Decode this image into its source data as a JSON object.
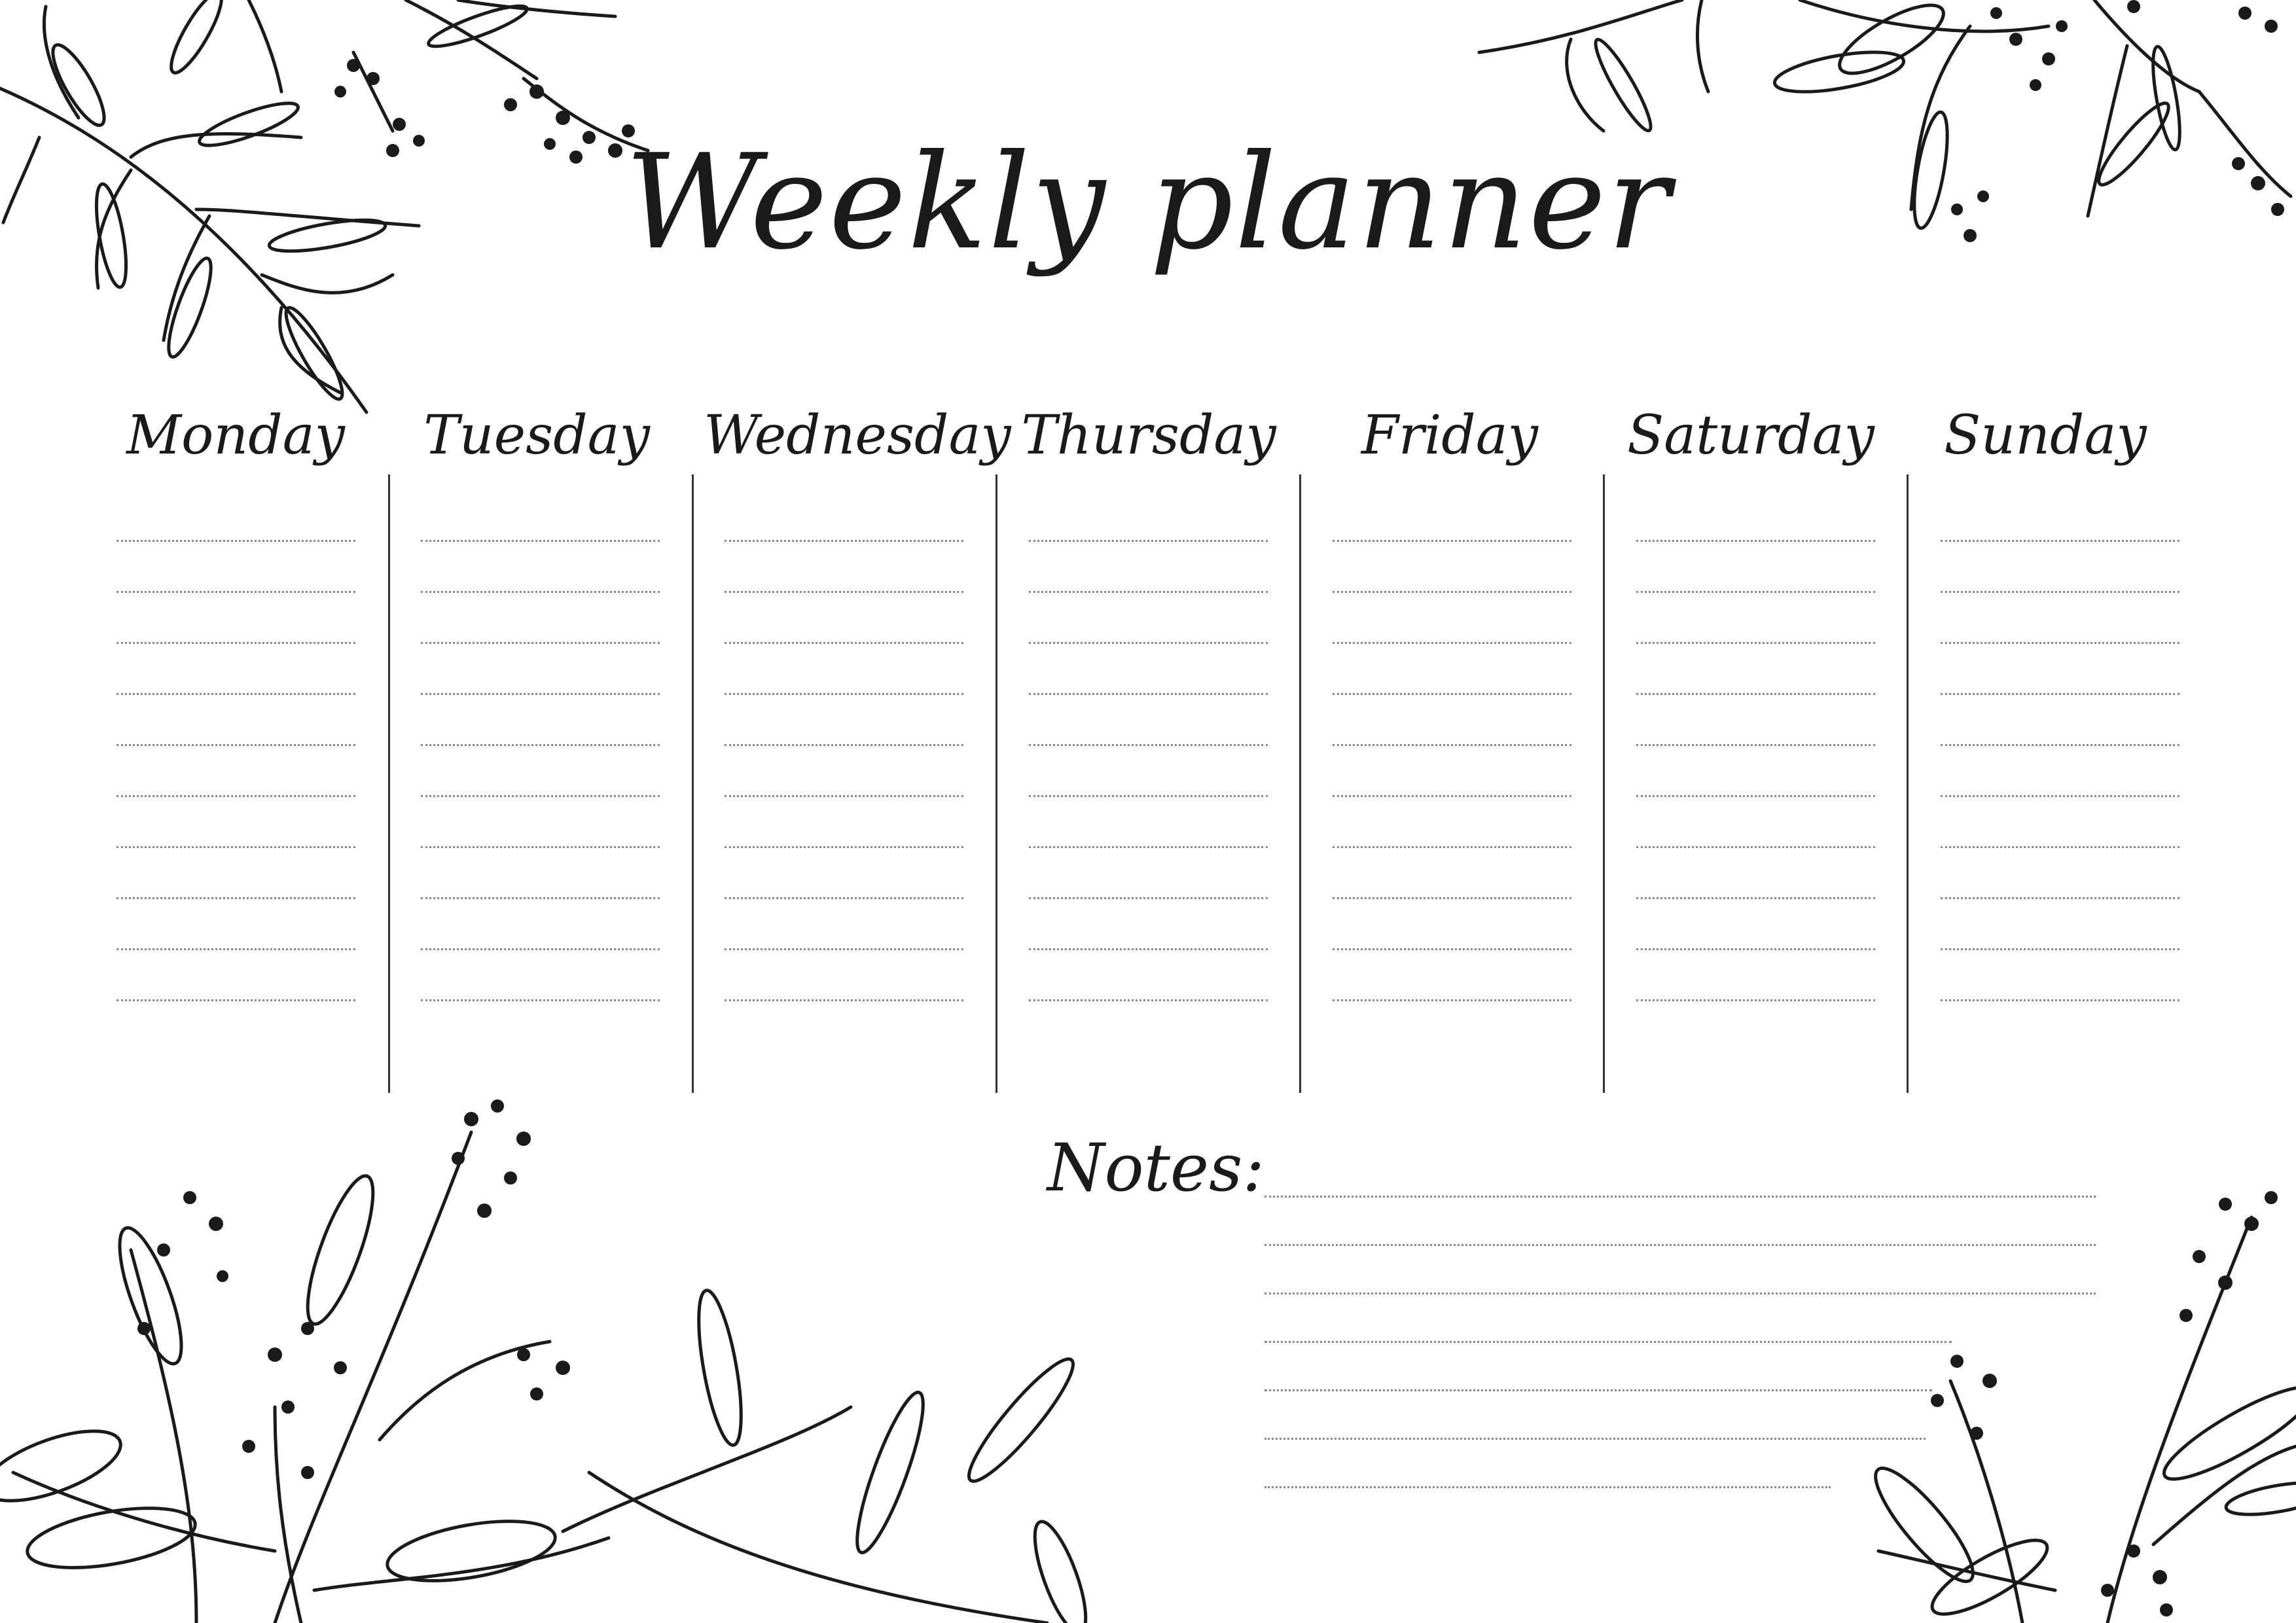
{
  "title": "Weekly planner",
  "days": [
    "Monday",
    "Tuesday",
    "Wednesday",
    "Thursday",
    "Friday",
    "Saturday",
    "Sunday"
  ],
  "notes_label": "Notes:",
  "lines_per_day": 10,
  "notes_line_count": 7,
  "colors": {
    "ink": "#1a1a1a",
    "divider": "#333333",
    "dotted_line": "#8a8a8a",
    "background": "#ffffff"
  }
}
